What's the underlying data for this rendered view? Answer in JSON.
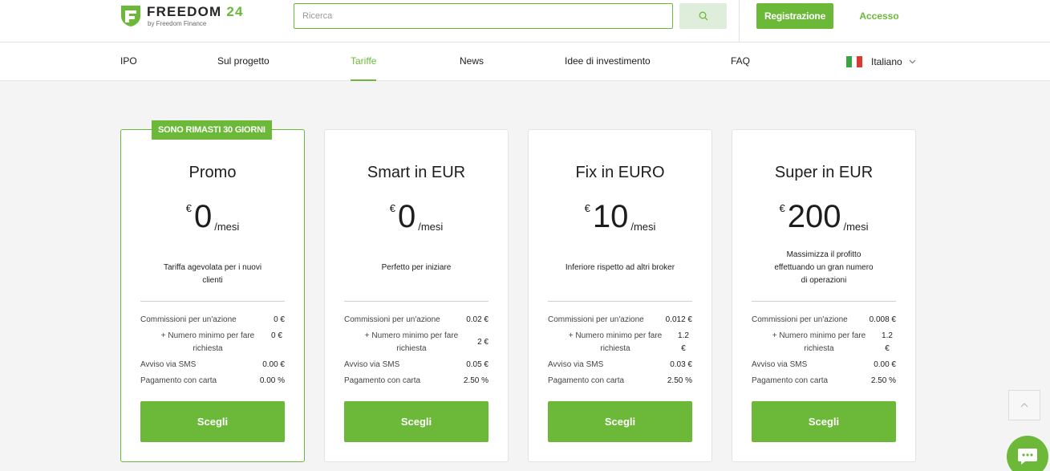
{
  "brand": {
    "name": "FREEDOM",
    "number": "24",
    "tagline": "by Freedom Finance",
    "color": "#6cb93a"
  },
  "search": {
    "placeholder": "Ricerca",
    "icon": "search-icon"
  },
  "auth": {
    "register_label": "Registrazione",
    "login_label": "Accesso"
  },
  "nav": {
    "items": [
      {
        "label": "IPO"
      },
      {
        "label": "Sul progetto"
      },
      {
        "label": "Tariffe",
        "active": true
      },
      {
        "label": "News"
      },
      {
        "label": "Idee di investimento"
      },
      {
        "label": "FAQ"
      }
    ],
    "language": {
      "label": "Italiano",
      "flag": "italy-flag-icon"
    }
  },
  "plans": [
    {
      "badge": "SONO RIMASTI 30 GIORNI",
      "name": "Promo",
      "currency": "€",
      "price": "0",
      "period": "/mesi",
      "description": "Tariffa agevolata per i nuovi clienti",
      "rows": [
        {
          "label": "Commissioni per un'azione",
          "value": "0 €"
        },
        {
          "label": "+ Numero minimo per fare richiesta",
          "value": "0 €"
        },
        {
          "label": "Avviso via SMS",
          "value": "0.00 €"
        },
        {
          "label": "Pagamento con carta",
          "value": "0.00 %"
        }
      ],
      "button": "Scegli"
    },
    {
      "name": "Smart in EUR",
      "currency": "€",
      "price": "0",
      "period": "/mesi",
      "description": "Perfetto per iniziare",
      "rows": [
        {
          "label": "Commissioni per un'azione",
          "value": "0.02 €"
        },
        {
          "label": "+ Numero minimo per fare richiesta",
          "value": "2 €"
        },
        {
          "label": "Avviso via SMS",
          "value": "0.05 €"
        },
        {
          "label": "Pagamento con carta",
          "value": "2.50 %"
        }
      ],
      "button": "Scegli"
    },
    {
      "name": "Fix in EURO",
      "currency": "€",
      "price": "10",
      "period": "/mesi",
      "description": "Inferiore rispetto ad altri broker",
      "rows": [
        {
          "label": "Commissioni per un'azione",
          "value": "0.012 €"
        },
        {
          "label": "+ Numero minimo per fare richiesta",
          "value": "1.2 €"
        },
        {
          "label": "Avviso via SMS",
          "value": "0.03 €"
        },
        {
          "label": "Pagamento con carta",
          "value": "2.50 %"
        }
      ],
      "button": "Scegli"
    },
    {
      "name": "Super in EUR",
      "currency": "€",
      "price": "200",
      "period": "/mesi",
      "description": "Massimizza il profitto effettuando un gran numero di operazioni",
      "rows": [
        {
          "label": "Commissioni per un'azione",
          "value": "0.008 €"
        },
        {
          "label": "+ Numero minimo per fare richiesta",
          "value": "1.2 €"
        },
        {
          "label": "Avviso via SMS",
          "value": "0.00 €"
        },
        {
          "label": "Pagamento con carta",
          "value": "2.50 %"
        }
      ],
      "button": "Scegli"
    }
  ]
}
